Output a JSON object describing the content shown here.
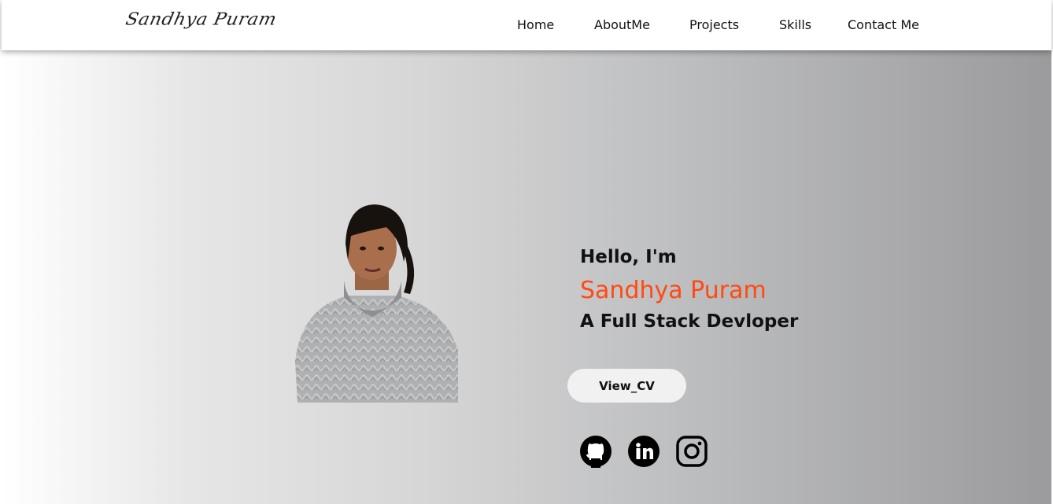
{
  "header": {
    "logo_text": "Sandhya Puram",
    "nav": [
      {
        "label": "Home"
      },
      {
        "label": "AboutMe"
      },
      {
        "label": "Projects"
      },
      {
        "label": "Skills"
      },
      {
        "label": "Contact Me"
      }
    ]
  },
  "hero": {
    "greeting": "Hello, I'm",
    "name": "Sandhya Puram",
    "role": "A Full Stack Devloper",
    "cv_button": "View_CV",
    "accent_color": "#ff4a12",
    "social_icons": [
      "github-icon",
      "linkedin-icon",
      "instagram-icon"
    ]
  }
}
